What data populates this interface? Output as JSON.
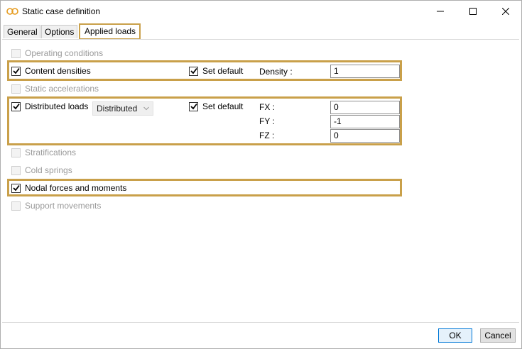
{
  "window": {
    "title": "Static case definition",
    "minimize_label": "Minimize",
    "maximize_label": "Maximize",
    "close_label": "Close"
  },
  "tabs": [
    {
      "label": "General"
    },
    {
      "label": "Options"
    },
    {
      "label": "Applied loads"
    }
  ],
  "loads": {
    "operating_conditions": {
      "label": "Operating conditions",
      "checked": false,
      "enabled": false
    },
    "content_densities": {
      "label": "Content densities",
      "checked": true,
      "enabled": true,
      "set_default_label": "Set default",
      "set_default_checked": true,
      "density_label": "Density :",
      "density_value": "1"
    },
    "static_accelerations": {
      "label": "Static accelerations",
      "checked": false,
      "enabled": false
    },
    "distributed_loads": {
      "label": "Distributed loads",
      "checked": true,
      "enabled": true,
      "type_value": "Distributed",
      "set_default_label": "Set default",
      "set_default_checked": true,
      "fx_label": "FX :",
      "fx_value": "0",
      "fy_label": "FY :",
      "fy_value": "-1",
      "fz_label": "FZ :",
      "fz_value": "0"
    },
    "stratifications": {
      "label": "Stratifications",
      "checked": false,
      "enabled": false
    },
    "cold_springs": {
      "label": "Cold springs",
      "checked": false,
      "enabled": false
    },
    "nodal_forces": {
      "label": "Nodal forces and moments",
      "checked": true,
      "enabled": true
    },
    "support_movements": {
      "label": "Support movements",
      "checked": false,
      "enabled": false
    }
  },
  "buttons": {
    "ok_label": "OK",
    "cancel_label": "Cancel"
  },
  "colors": {
    "highlight": "#c9a04a",
    "disabled_text": "#9a9a9a",
    "ok_border": "#0078d7"
  }
}
